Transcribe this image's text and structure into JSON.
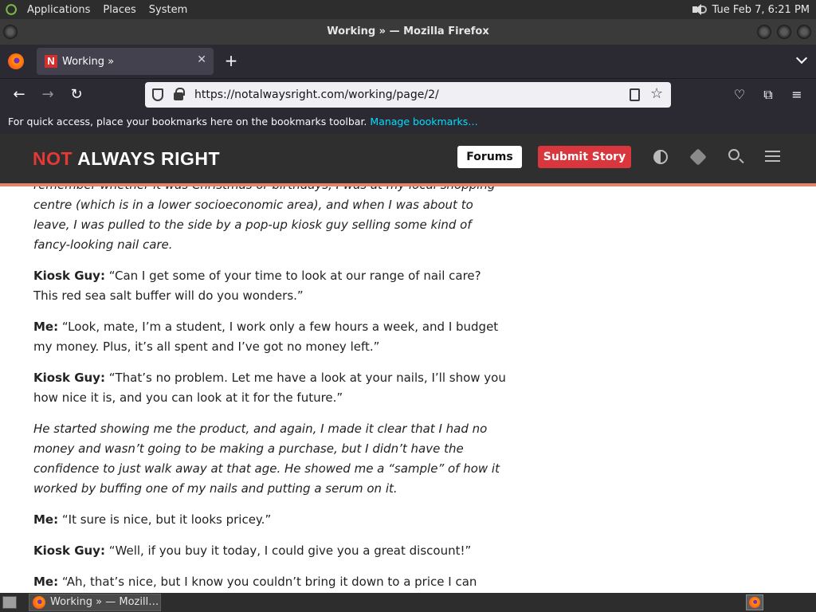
{
  "top_panel": {
    "menus": [
      "Applications",
      "Places",
      "System"
    ],
    "clock": "Tue Feb  7,  6:21 PM"
  },
  "window": {
    "title": "Working » — Mozilla Firefox"
  },
  "tabs": [
    {
      "label": "Working »",
      "favicon": "N"
    }
  ],
  "urlbar": {
    "url": "https://notalwaysright.com/working/page/2/"
  },
  "bookmarks_bar": {
    "message": "For quick access, place your bookmarks here on the bookmarks toolbar.",
    "link": "Manage bookmarks…"
  },
  "site": {
    "logo_not": "NOT",
    "logo_rest": " ALWAYS RIGHT",
    "forums": "Forums",
    "submit": "Submit Story",
    "accent": "#d9373d",
    "stripe": "#e3836a"
  },
  "article": {
    "paragraphs": [
      {
        "italic": true,
        "speaker": "",
        "text": "remember whether it was Christmas or birthdays, I was at my local shopping centre (which is in a lower socioeconomic area), and when I was about to leave, I was pulled to the side by a pop-up kiosk guy selling some kind of fancy-looking nail care."
      },
      {
        "italic": false,
        "speaker": "Kiosk Guy:",
        "text": " “Can I get some of your time to look at our range of nail care? This red sea salt buffer will do you wonders.”"
      },
      {
        "italic": false,
        "speaker": "Me:",
        "text": " “Look, mate, I’m a student, I work only a few hours a week, and I budget my money. Plus, it’s all spent and I’ve got no money left.”"
      },
      {
        "italic": false,
        "speaker": "Kiosk Guy:",
        "text": " “That’s no problem. Let me have a look at your nails, I’ll show you how nice it is, and you can look at it for the future.”"
      },
      {
        "italic": true,
        "speaker": "",
        "text": "He started showing me the product, and again, I made it clear that I had no money and wasn’t going to be making a purchase, but I didn’t have the confidence to just walk away at that age. He showed me a “sample” of how it worked by buffing one of my nails and putting a serum on it."
      },
      {
        "italic": false,
        "speaker": "Me:",
        "text": " “It sure is nice, but it looks pricey.”"
      },
      {
        "italic": false,
        "speaker": "Kiosk Guy:",
        "text": " “Well, if you buy it today, I could give you a great discount!”"
      },
      {
        "italic": false,
        "speaker": "Me:",
        "text": " “Ah, that’s nice, but I know you couldn’t bring it down to a price I can"
      }
    ]
  },
  "taskbar": {
    "task_label": "Working » — Mozill…"
  }
}
